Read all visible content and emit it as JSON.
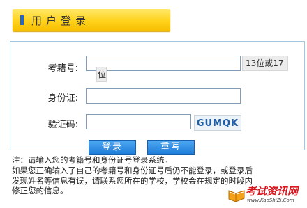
{
  "header": {
    "title": "用户登录"
  },
  "form": {
    "exam_id_label": "考籍号:",
    "exam_id_hint_part1": "13位或17",
    "exam_id_hint_part2": "位",
    "id_card_label": "身份证:",
    "captcha_label": "验证码:",
    "captcha_code": "GUMQK",
    "exam_id_value": "",
    "id_card_value": "",
    "captcha_value": ""
  },
  "buttons": {
    "login": "登录",
    "reset": "重写"
  },
  "notice": {
    "lines": [
      "注：请输入您的考籍号和身份证号登录系统。",
      "如果您正确输入了自己的考籍号和身份证号后仍不能登录，或登录后",
      "发现姓名等信息有误，请联系您所在的学校，学校会在规定的时段内",
      "修正您的信息。"
    ]
  },
  "watermark": {
    "name": "考试资讯网",
    "url": "www.KaoShiZi.Com"
  },
  "colors": {
    "title_bar": "#ffd21a",
    "title_mark": "#2266cc",
    "button": "#1c7bd8",
    "box_border": "#9fc7e8",
    "watermark": "#d8141c"
  }
}
